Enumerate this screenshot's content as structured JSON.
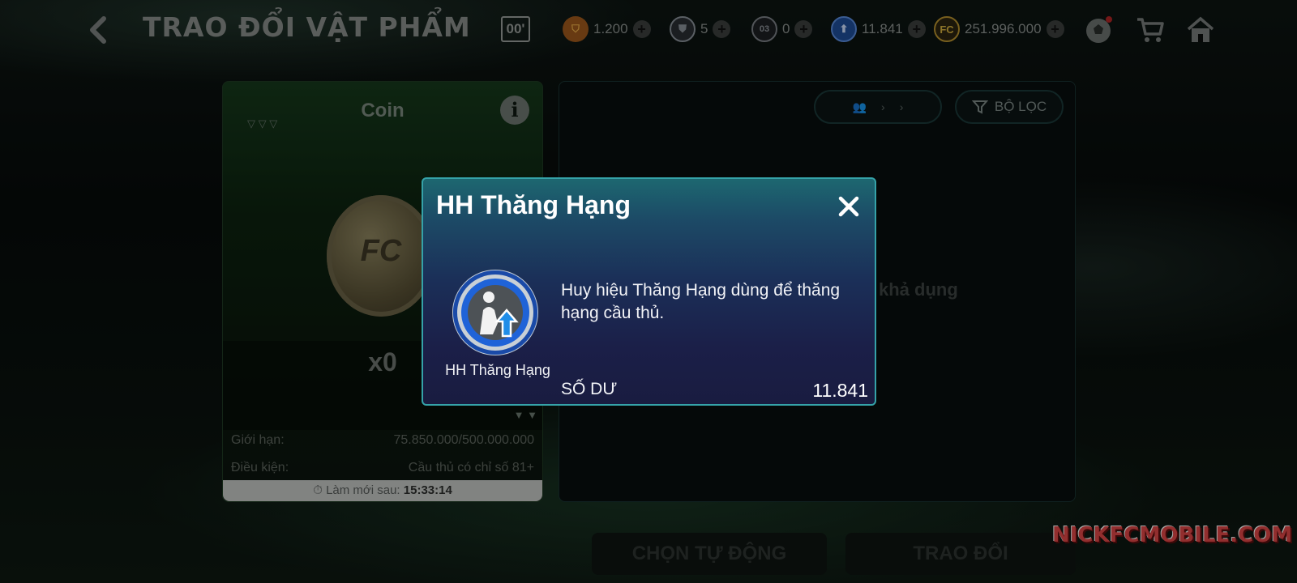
{
  "header": {
    "title": "TRAO ĐỔI VẬT PHẨM",
    "timer_box": "00'",
    "currencies": [
      {
        "icon": "gold-crest-icon",
        "value": "1.200",
        "color": "#c9782a"
      },
      {
        "icon": "shield-icon",
        "value": "5",
        "color": "#9aa3ad"
      },
      {
        "icon": "chip-icon",
        "value": "0",
        "color": "#8f949a"
      },
      {
        "icon": "rank-up-badge-icon",
        "value": "11.841",
        "color": "#3d7bd8"
      },
      {
        "icon": "fc-coin-icon",
        "value": "251.996.000",
        "color": "#c9a23a"
      }
    ]
  },
  "left_panel": {
    "title": "Coin",
    "count": "x0",
    "limit_label": "Giới hạn:",
    "limit_value": "75.850.000/500.000.000",
    "condition_label": "Điều kiện:",
    "condition_value": "Cầu thủ có chỉ số 81+",
    "refresh_label": "Làm mới sau:",
    "refresh_time": "15:33:14"
  },
  "right_panel": {
    "filter_label": "BỘ LỌC",
    "empty_note": "khả dụng"
  },
  "bottom": {
    "auto_select": "CHỌN TỰ ĐỘNG",
    "exchange": "TRAO ĐỔI"
  },
  "watermark": "NICKFCMOBILE.COM",
  "modal": {
    "title": "HH Thăng Hạng",
    "description": "Huy hiệu Thăng Hạng dùng để thăng hạng cầu thủ.",
    "item_label": "HH Thăng Hạng",
    "balance_label": "SỐ DƯ",
    "balance_value": "11.841"
  }
}
